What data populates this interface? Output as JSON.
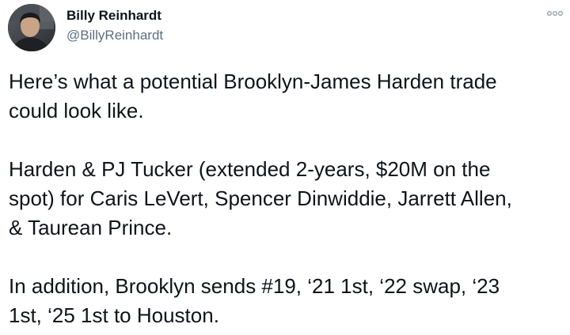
{
  "tweet": {
    "author": {
      "display_name": "Billy Reinhardt",
      "handle": "@BillyReinhardt",
      "avatar_icon": "profile-photo"
    },
    "more_icon": "more-options-icon",
    "paragraphs": [
      "Here’s what a potential Brooklyn-James Harden trade\ncould look like.",
      "Harden & PJ Tucker (extended 2-years, $20M on the\nspot) for Caris LeVert, Spencer Dinwiddie, Jarrett Allen,\n& Taurean Prince.",
      "In addition, Brooklyn sends #19, ‘21 1st, ‘22 swap, ‘23\n1st, ‘25 1st to Houston."
    ]
  },
  "colors": {
    "text": "#0f1419",
    "secondary_text": "#5b7083",
    "background": "#ffffff"
  }
}
